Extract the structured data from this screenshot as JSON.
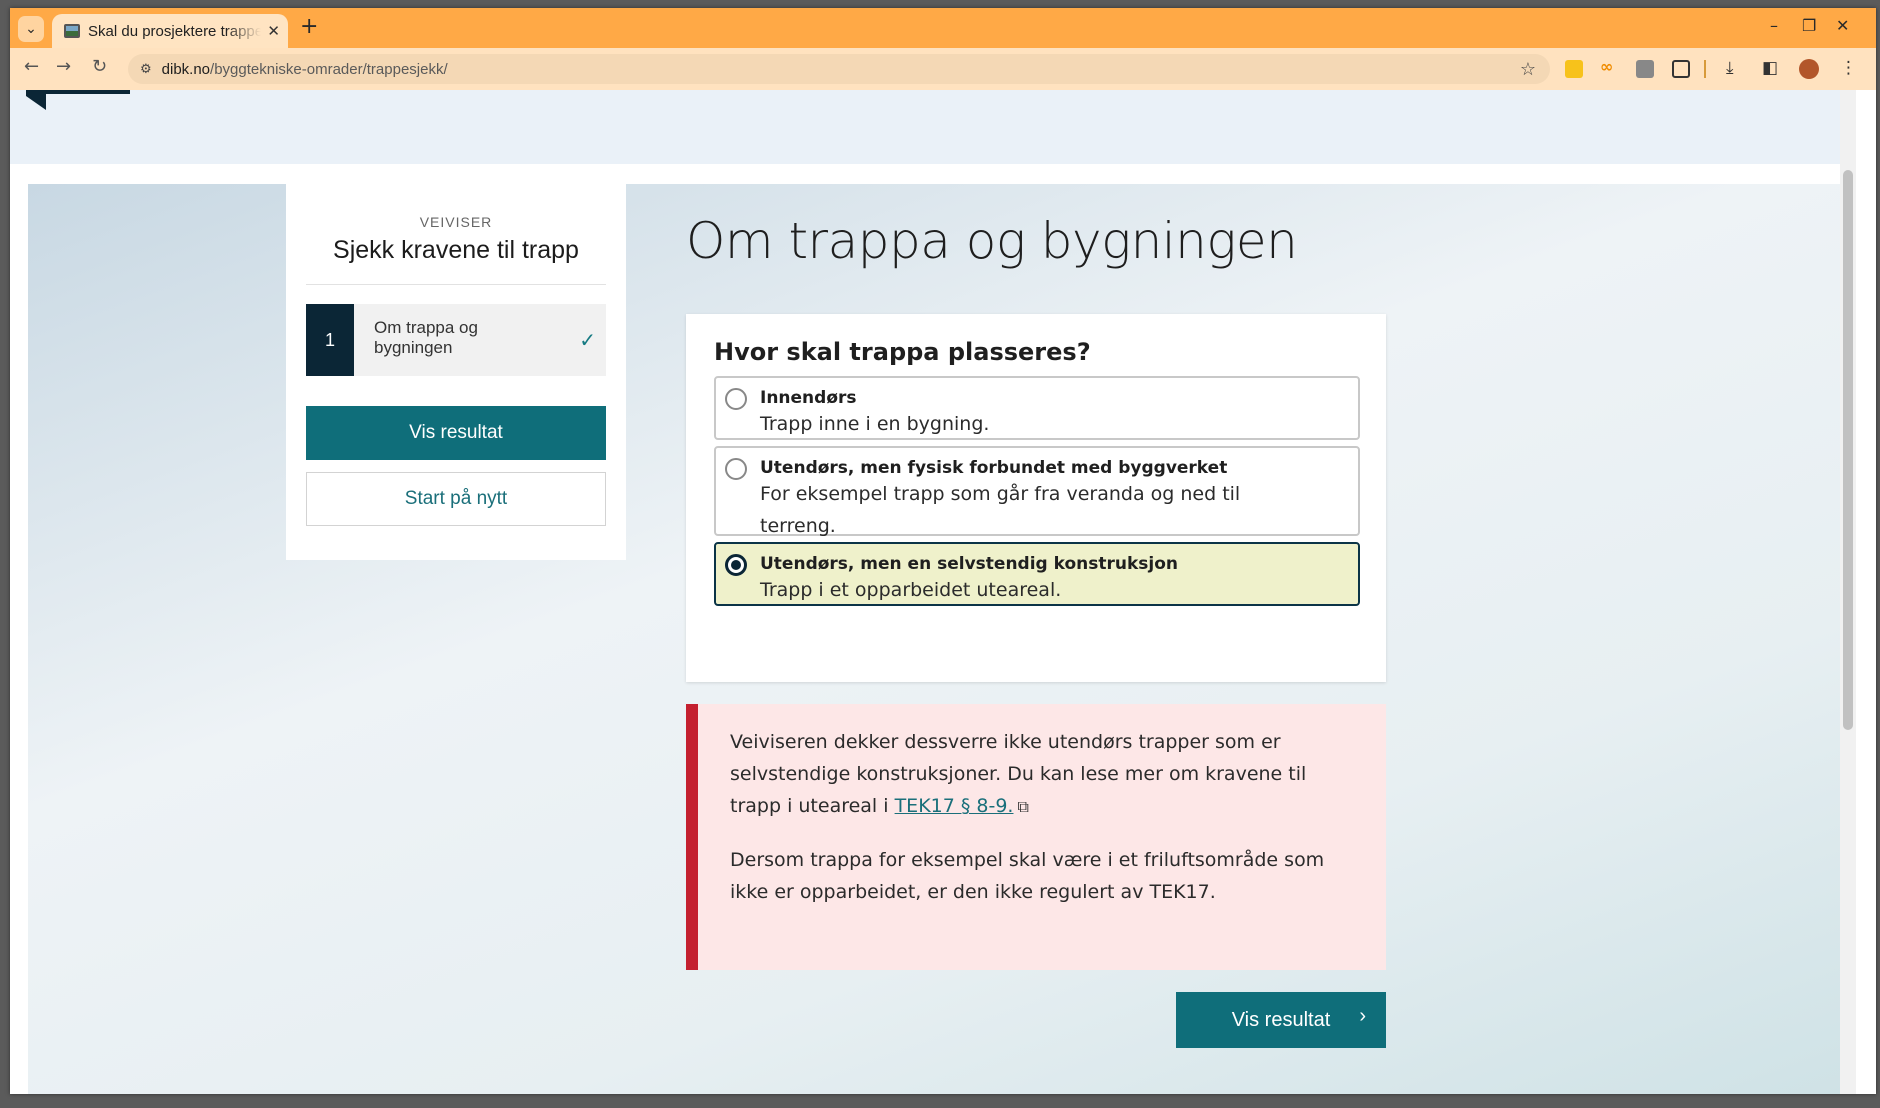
{
  "browser": {
    "tab_title": "Skal du prosjektere trappesjekk",
    "url_host": "dibk.no",
    "url_path": "/byggtekniske-omrader/trappesjekk/",
    "new_tab": "+",
    "close_tab": "✕",
    "win_minimize": "–",
    "win_restore": "❐",
    "win_close": "✕",
    "back": "←",
    "forward": "→",
    "reload": "↻",
    "tab_search": "⌄",
    "site_info": "⚙",
    "star": "☆",
    "ext_2": "∞",
    "download": "⤓",
    "sidepanel": "◧",
    "menu": "⋮"
  },
  "sidebar": {
    "eyebrow": "VEIVISER",
    "title": "Sjekk kravene til trapp",
    "step": {
      "number": "1",
      "label": "Om trappa og bygningen",
      "check": "✓"
    },
    "primary_button": "Vis resultat",
    "secondary_button": "Start på nytt"
  },
  "main": {
    "title": "Om trappa og bygningen",
    "question": {
      "title": "Hvor skal trappa plasseres?",
      "options": [
        {
          "title": "Innendørs",
          "desc": "Trapp inne i en bygning.",
          "selected": false
        },
        {
          "title": "Utendørs, men fysisk forbundet med byggverket",
          "desc": "For eksempel trapp som går fra veranda og ned til terreng.",
          "selected": false
        },
        {
          "title": "Utendørs, men en selvstendig konstruksjon",
          "desc": "Trapp i et opparbeidet uteareal.",
          "selected": true
        }
      ]
    },
    "alert": {
      "p1_before": "Veiviseren dekker dessverre ikke utendørs trapper som er selvstendige konstruksjoner. Du kan lese mer om kravene til trapp i uteareal i ",
      "p1_link": "TEK17 § 8-9.",
      "p1_link_icon": "⧉",
      "p2": "Dersom trappa for eksempel skal være i et friluftsområde som ikke er opparbeidet, er den ikke regulert av TEK17."
    },
    "next_button": "Vis resultat",
    "next_chevron": "›"
  },
  "colors": {
    "accent": "#0f6e7a",
    "dark": "#0b2636",
    "alert_border": "#c4202f",
    "alert_bg": "#fde7e7",
    "selected_bg": "#eff1cb",
    "chrome_tabstrip": "#ffa946"
  }
}
